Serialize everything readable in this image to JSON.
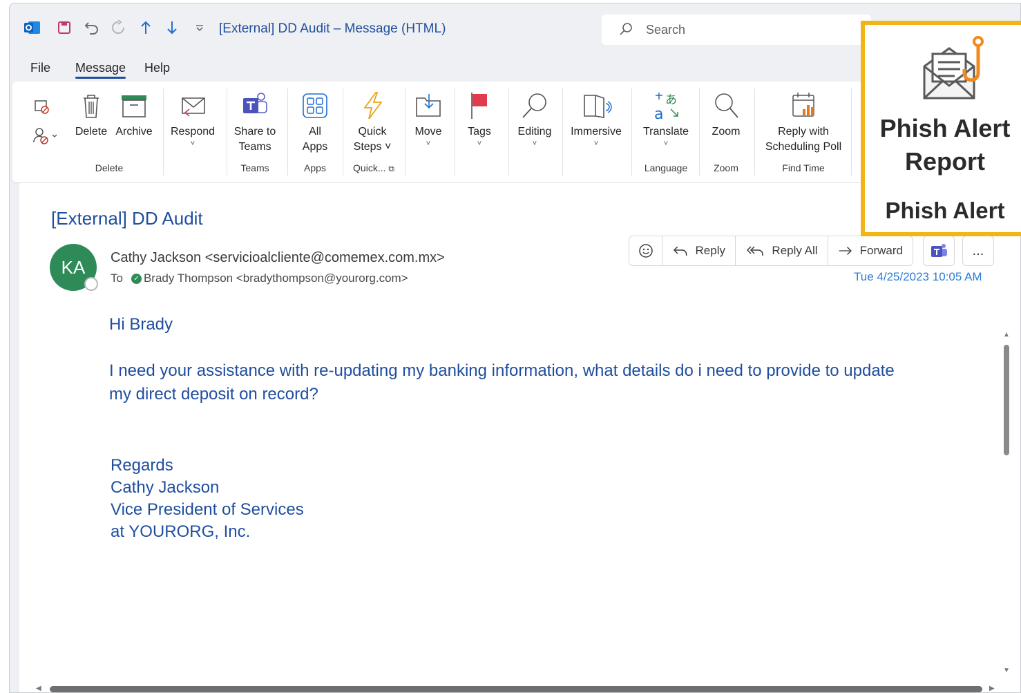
{
  "window": {
    "title": "[External] DD Audit – Message (HTML)",
    "search_placeholder": "Search"
  },
  "menu": {
    "tabs": [
      "File",
      "Message",
      "Help"
    ],
    "active": "Message"
  },
  "ribbon": {
    "delete_label": "Delete",
    "archive_label": "Archive",
    "respond_label": "Respond",
    "share_label_1": "Share to",
    "share_label_2": "Teams",
    "allapps_label_1": "All",
    "allapps_label_2": "Apps",
    "quick_label_1": "Quick",
    "quick_label_2": "Steps ˅",
    "move_label": "Move",
    "tags_label": "Tags",
    "editing_label": "Editing",
    "immersive_label": "Immersive",
    "translate_label": "Translate",
    "zoom_label": "Zoom",
    "poll_label_1": "Reply with",
    "poll_label_2": "Scheduling Poll",
    "groups": {
      "delete": "Delete",
      "teams": "Teams",
      "apps": "Apps",
      "quick": "Quick...",
      "language": "Language",
      "zoom": "Zoom",
      "findtime": "Find Time"
    }
  },
  "message": {
    "subject": "[External] DD Audit",
    "avatar_initials": "KA",
    "from": "Cathy Jackson <servicioalcliente@comemex.com.mx>",
    "to_label": "To",
    "to": "Brady Thompson <bradythompson@yourorg.com>",
    "date": "Tue 4/25/2023 10:05 AM",
    "actions": {
      "reply": "Reply",
      "reply_all": "Reply All",
      "forward": "Forward",
      "more": "..."
    },
    "body": {
      "greeting": "Hi Brady",
      "line1": "I need your assistance with re-updating my banking information, what details do i need to provide to update",
      "line2": "my direct deposit on record?",
      "sign1": "Regards",
      "sign2": "Cathy Jackson",
      "sign3": "Vice President of Services",
      "sign4": "at YOURORG, Inc."
    }
  },
  "phish_alert": {
    "label_1": "Phish Alert",
    "label_2": "Report",
    "group": "Phish Alert",
    "highlight_color": "#f2b517"
  },
  "colors": {
    "accent": "#1f4e9e",
    "link": "#2b7cd3",
    "avatar": "#2e8b57"
  }
}
